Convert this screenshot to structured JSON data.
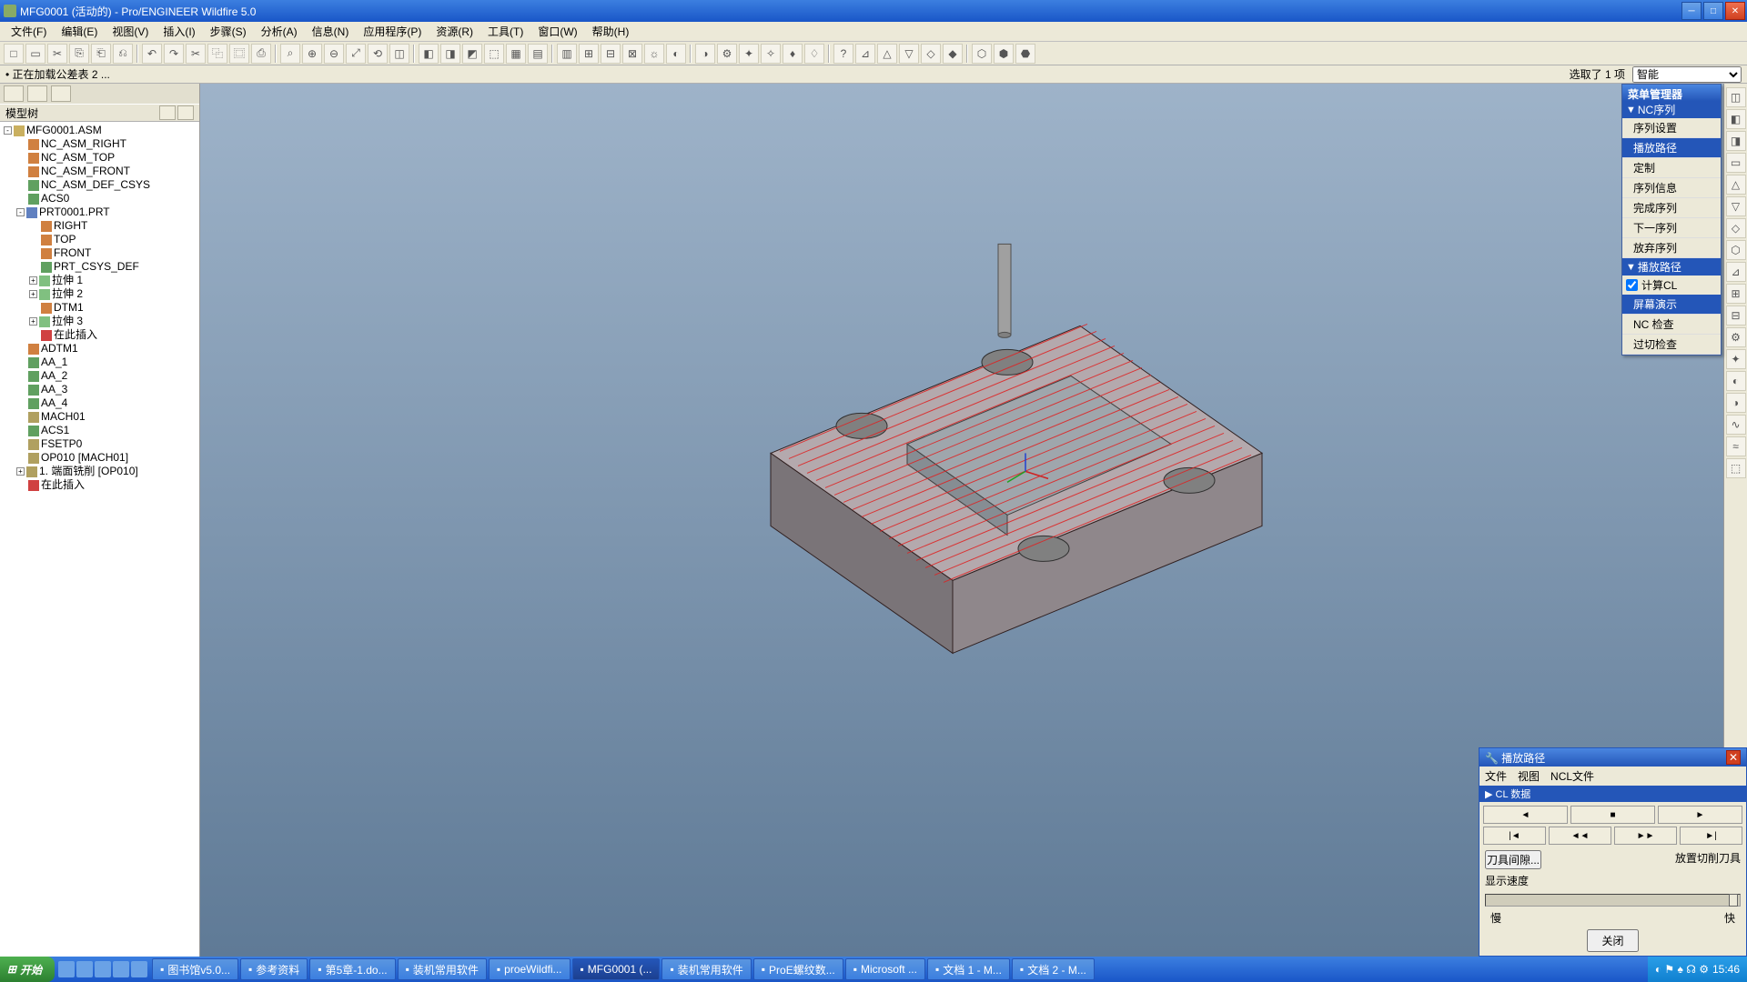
{
  "title": "MFG0001 (活动的) - Pro/ENGINEER Wildfire 5.0",
  "menus": [
    "文件(F)",
    "编辑(E)",
    "视图(V)",
    "插入(I)",
    "步骤(S)",
    "分析(A)",
    "信息(N)",
    "应用程序(P)",
    "资源(R)",
    "工具(T)",
    "窗口(W)",
    "帮助(H)"
  ],
  "status_left": "• 正在加载公差表 2 ...",
  "status_sel": "选取了 1 项",
  "smart_option": "智能",
  "tree_header": "模型树",
  "tree": [
    {
      "l": 0,
      "ic": "asm",
      "t": "MFG0001.ASM",
      "ex": "-"
    },
    {
      "l": 1,
      "ic": "dtm",
      "t": "NC_ASM_RIGHT"
    },
    {
      "l": 1,
      "ic": "dtm",
      "t": "NC_ASM_TOP"
    },
    {
      "l": 1,
      "ic": "dtm",
      "t": "NC_ASM_FRONT"
    },
    {
      "l": 1,
      "ic": "csys",
      "t": "NC_ASM_DEF_CSYS"
    },
    {
      "l": 1,
      "ic": "csys",
      "t": "ACS0"
    },
    {
      "l": 1,
      "ic": "prt",
      "t": "PRT0001.PRT",
      "ex": "-"
    },
    {
      "l": 2,
      "ic": "dtm",
      "t": "RIGHT"
    },
    {
      "l": 2,
      "ic": "dtm",
      "t": "TOP"
    },
    {
      "l": 2,
      "ic": "dtm",
      "t": "FRONT"
    },
    {
      "l": 2,
      "ic": "csys",
      "t": "PRT_CSYS_DEF"
    },
    {
      "l": 2,
      "ic": "feat",
      "t": "拉伸 1",
      "ex": "+"
    },
    {
      "l": 2,
      "ic": "feat",
      "t": "拉伸 2",
      "ex": "+"
    },
    {
      "l": 2,
      "ic": "dtm",
      "t": "DTM1"
    },
    {
      "l": 2,
      "ic": "feat",
      "t": "拉伸 3",
      "ex": "+"
    },
    {
      "l": 2,
      "ic": "red",
      "t": "在此插入"
    },
    {
      "l": 1,
      "ic": "dtm",
      "t": "ADTM1"
    },
    {
      "l": 1,
      "ic": "csys",
      "t": "AA_1"
    },
    {
      "l": 1,
      "ic": "csys",
      "t": "AA_2"
    },
    {
      "l": 1,
      "ic": "csys",
      "t": "AA_3"
    },
    {
      "l": 1,
      "ic": "csys",
      "t": "AA_4"
    },
    {
      "l": 1,
      "ic": "op",
      "t": "MACH01"
    },
    {
      "l": 1,
      "ic": "csys",
      "t": "ACS1"
    },
    {
      "l": 1,
      "ic": "op",
      "t": "FSETP0"
    },
    {
      "l": 1,
      "ic": "op",
      "t": "OP010 [MACH01]"
    },
    {
      "l": 1,
      "ic": "op",
      "t": "1. 端面铣削 [OP010]",
      "ex": "+"
    },
    {
      "l": 1,
      "ic": "red",
      "t": "在此插入"
    }
  ],
  "menumgr": {
    "title": "菜单管理器",
    "sec1": "NC序列",
    "items1": [
      "序列设置",
      "播放路径",
      "定制",
      "序列信息",
      "完成序列",
      "下一序列",
      "放弃序列"
    ],
    "sel1": "播放路径",
    "sec2": "播放路径",
    "check": "计算CL",
    "items2": [
      "屏幕演示",
      "NC 检查",
      "过切检查"
    ],
    "sel2": "屏幕演示"
  },
  "playdlg": {
    "title": "播放路径",
    "menus": [
      "文件",
      "视图",
      "NCL文件"
    ],
    "bar": "▶ CL 数据",
    "tool_gap": "刀具间隙...",
    "place_tool": "放置切削刀具",
    "speed_label": "显示速度",
    "slow": "慢",
    "fast": "快",
    "close": "关闭"
  },
  "taskbar": {
    "start": "开始",
    "tasks": [
      "图书馆v5.0...",
      "参考资料",
      "第5章-1.do...",
      "装机常用软件",
      "proeWildfi...",
      "MFG0001 (...",
      "装机常用软件",
      "ProE螺纹数...",
      "Microsoft ...",
      "文档 1 - M...",
      "文档 2 - M..."
    ],
    "active": 5,
    "time": "15:46"
  }
}
